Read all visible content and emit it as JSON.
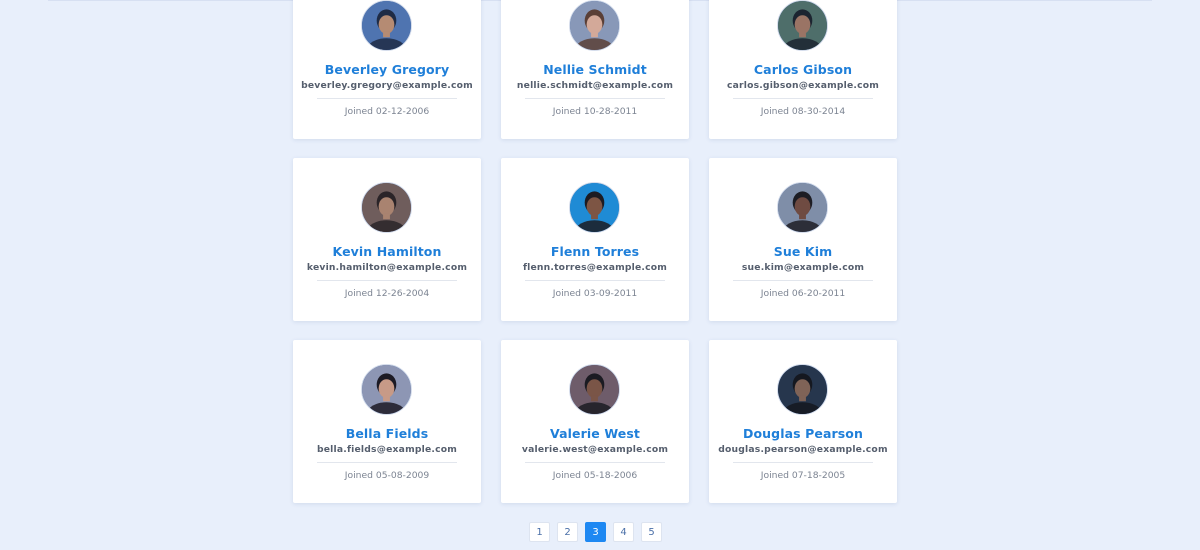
{
  "users": [
    {
      "name": "Beverley Gregory",
      "email": "beverley.gregory@example.com",
      "joined": "Joined 02-12-2006",
      "avatar": {
        "bg": "#4f74b0",
        "skin": "#b58b73",
        "hair": "#1f2b45"
      }
    },
    {
      "name": "Nellie Schmidt",
      "email": "nellie.schmidt@example.com",
      "joined": "Joined 10-28-2011",
      "avatar": {
        "bg": "#8898b8",
        "skin": "#d3a999",
        "hair": "#5a3f36"
      }
    },
    {
      "name": "Carlos Gibson",
      "email": "carlos.gibson@example.com",
      "joined": "Joined 08-30-2014",
      "avatar": {
        "bg": "#4e6e6a",
        "skin": "#9a7465",
        "hair": "#1c2430"
      }
    },
    {
      "name": "Kevin Hamilton",
      "email": "kevin.hamilton@example.com",
      "joined": "Joined 12-26-2004",
      "avatar": {
        "bg": "#6f5d5c",
        "skin": "#a98370",
        "hair": "#2a2428"
      }
    },
    {
      "name": "Flenn Torres",
      "email": "flenn.torres@example.com",
      "joined": "Joined 03-09-2011",
      "avatar": {
        "bg": "#1f8bd5",
        "skin": "#7d5544",
        "hair": "#1c1b22"
      }
    },
    {
      "name": "Sue Kim",
      "email": "sue.kim@example.com",
      "joined": "Joined 06-20-2011",
      "avatar": {
        "bg": "#7f8ea8",
        "skin": "#6f4b42",
        "hair": "#1d1d24"
      }
    },
    {
      "name": "Bella Fields",
      "email": "bella.fields@example.com",
      "joined": "Joined 05-08-2009",
      "avatar": {
        "bg": "#8d96b4",
        "skin": "#c79a87",
        "hair": "#1c1a24"
      }
    },
    {
      "name": "Valerie West",
      "email": "valerie.west@example.com",
      "joined": "Joined 05-18-2006",
      "avatar": {
        "bg": "#6e5c6a",
        "skin": "#7a5547",
        "hair": "#1b1b22"
      }
    },
    {
      "name": "Douglas Pearson",
      "email": "douglas.pearson@example.com",
      "joined": "Joined 07-18-2005",
      "avatar": {
        "bg": "#26364d",
        "skin": "#7f6357",
        "hair": "#151820"
      }
    }
  ],
  "pagination": {
    "pages": [
      "1",
      "2",
      "3",
      "4",
      "5"
    ],
    "current": "3"
  },
  "colors": {
    "background": "#e8effb",
    "accent": "#1e88f2",
    "name": "#1f7fd9"
  }
}
